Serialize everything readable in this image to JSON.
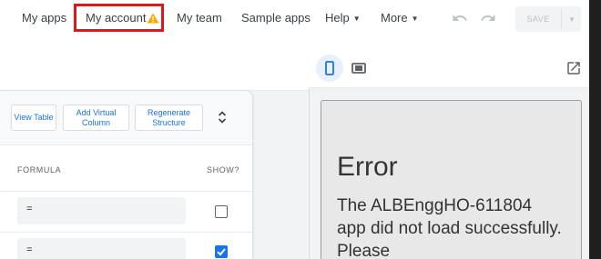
{
  "nav": {
    "my_apps": "My apps",
    "my_account": "My account",
    "my_team": "My team",
    "sample_apps": "Sample apps",
    "help": "Help",
    "more": "More",
    "save": "SAVE"
  },
  "icons": {
    "warning": "warning-icon",
    "undo": "undo-icon",
    "redo": "redo-icon",
    "dropdown": "caret-down-icon",
    "expand": "unfold-icon",
    "phone": "phone-icon",
    "tablet": "tablet-icon",
    "open": "open-in-new-icon"
  },
  "toolbar": {
    "view_table": "View Table",
    "add_virtual_column": "Add Virtual Column",
    "regenerate_structure": "Regenerate Structure"
  },
  "table": {
    "headers": {
      "formula": "FORMULA",
      "show": "SHOW?"
    },
    "rows": [
      {
        "formula": "=",
        "show": false
      },
      {
        "formula": "=",
        "show": true
      }
    ]
  },
  "preview": {
    "error_title": "Error",
    "error_message": "The ALBEnggHO-611804 app did not load successfully. Please"
  },
  "colors": {
    "accent": "#1a73e8",
    "highlight_box": "#e0181b",
    "warning": "#f9ab00"
  }
}
